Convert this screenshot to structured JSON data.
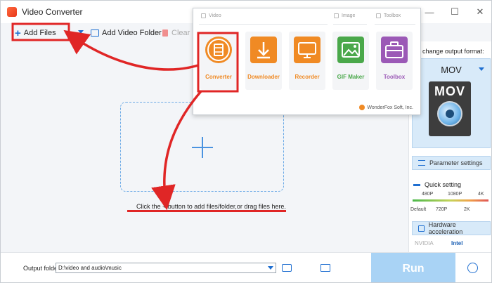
{
  "app": {
    "title": "Video Converter"
  },
  "window_controls": {
    "minimize": "—",
    "maximize": "☐",
    "close": "✕"
  },
  "toolbar": {
    "add_files": "Add Files",
    "add_video_folder": "Add Video Folder",
    "clear": "Clear"
  },
  "main": {
    "hint": "Click the + button to add files/folder,or drag files here."
  },
  "right_panel": {
    "format_hint": ": to change output format:",
    "format_name": "MOV",
    "format_icon_text": "MOV",
    "parameter_settings": "Parameter settings",
    "quick_setting": "Quick setting",
    "quality_top": [
      "480P",
      "1080P",
      "4K"
    ],
    "quality_bottom": [
      "Default",
      "720P",
      "2K"
    ],
    "hardware_acceleration": "Hardware acceleration",
    "gpu_nvidia": "NVIDIA",
    "gpu_intel": "Intel"
  },
  "bottom": {
    "output_label": "Output folder:",
    "output_path": "D:\\video and audio\\music",
    "run": "Run"
  },
  "popup": {
    "sections": {
      "video": "Video",
      "image": "Image",
      "toolbox": "Toolbox"
    },
    "tiles": [
      {
        "label": "Converter",
        "color": "#f08a24"
      },
      {
        "label": "Downloader",
        "color": "#f08a24"
      },
      {
        "label": "Recorder",
        "color": "#f08a24"
      },
      {
        "label": "GIF Maker",
        "color": "#4aa84a"
      },
      {
        "label": "Toolbox",
        "color": "#9b59b6"
      }
    ],
    "brand": "WonderFox Soft, Inc."
  },
  "colors": {
    "accent": "#1f6fd1",
    "annotation": "#e02626",
    "run_disabled": "#a9d3f5"
  }
}
